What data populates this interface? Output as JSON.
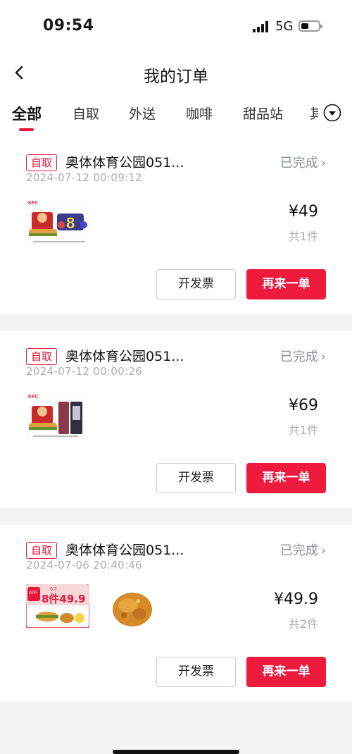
{
  "status_bar": {
    "time": "09:54",
    "network": "5G"
  },
  "header": {
    "title": "我的订单"
  },
  "tabs": [
    {
      "label": "全部",
      "active": true
    },
    {
      "label": "自取"
    },
    {
      "label": "外送"
    },
    {
      "label": "咖啡"
    },
    {
      "label": "甜品站"
    },
    {
      "label": "其"
    }
  ],
  "orders": [
    {
      "type_badge": "自取",
      "store": "奥体体育公园051...",
      "status": "已完成",
      "time": "2024-07-12 00:09:12",
      "thumbnails": [
        {
          "icon": "kfc-meal-combo-image",
          "logo_text": "KFC",
          "promo_text": "8"
        }
      ],
      "price": "¥49",
      "count": "共1件",
      "invoice_label": "开发票",
      "reorder_label": "再来一单"
    },
    {
      "type_badge": "自取",
      "store": "奥体体育公园051...",
      "status": "已完成",
      "time": "2024-07-12 00:00:26",
      "thumbnails": [
        {
          "icon": "kfc-meal-combo-image",
          "logo_text": "KFC"
        }
      ],
      "price": "¥69",
      "count": "共1件",
      "invoice_label": "开发票",
      "reorder_label": "再来一单"
    },
    {
      "type_badge": "自取",
      "store": "奥体体育公园051...",
      "status": "已完成",
      "time": "2024-07-06 20:40:46",
      "thumbnails": [
        {
          "icon": "promo-meal-image",
          "promo_text": "8件49.9",
          "tag_text": "APP",
          "corner_text": "6.2"
        },
        {
          "icon": "fried-chicken-image"
        }
      ],
      "price": "¥49.9",
      "count": "共2件",
      "invoice_label": "开发票",
      "reorder_label": "再来一单"
    }
  ],
  "colors": {
    "accent": "#ee1b3e",
    "muted": "#a7acb5",
    "status": "#8a8f99"
  }
}
